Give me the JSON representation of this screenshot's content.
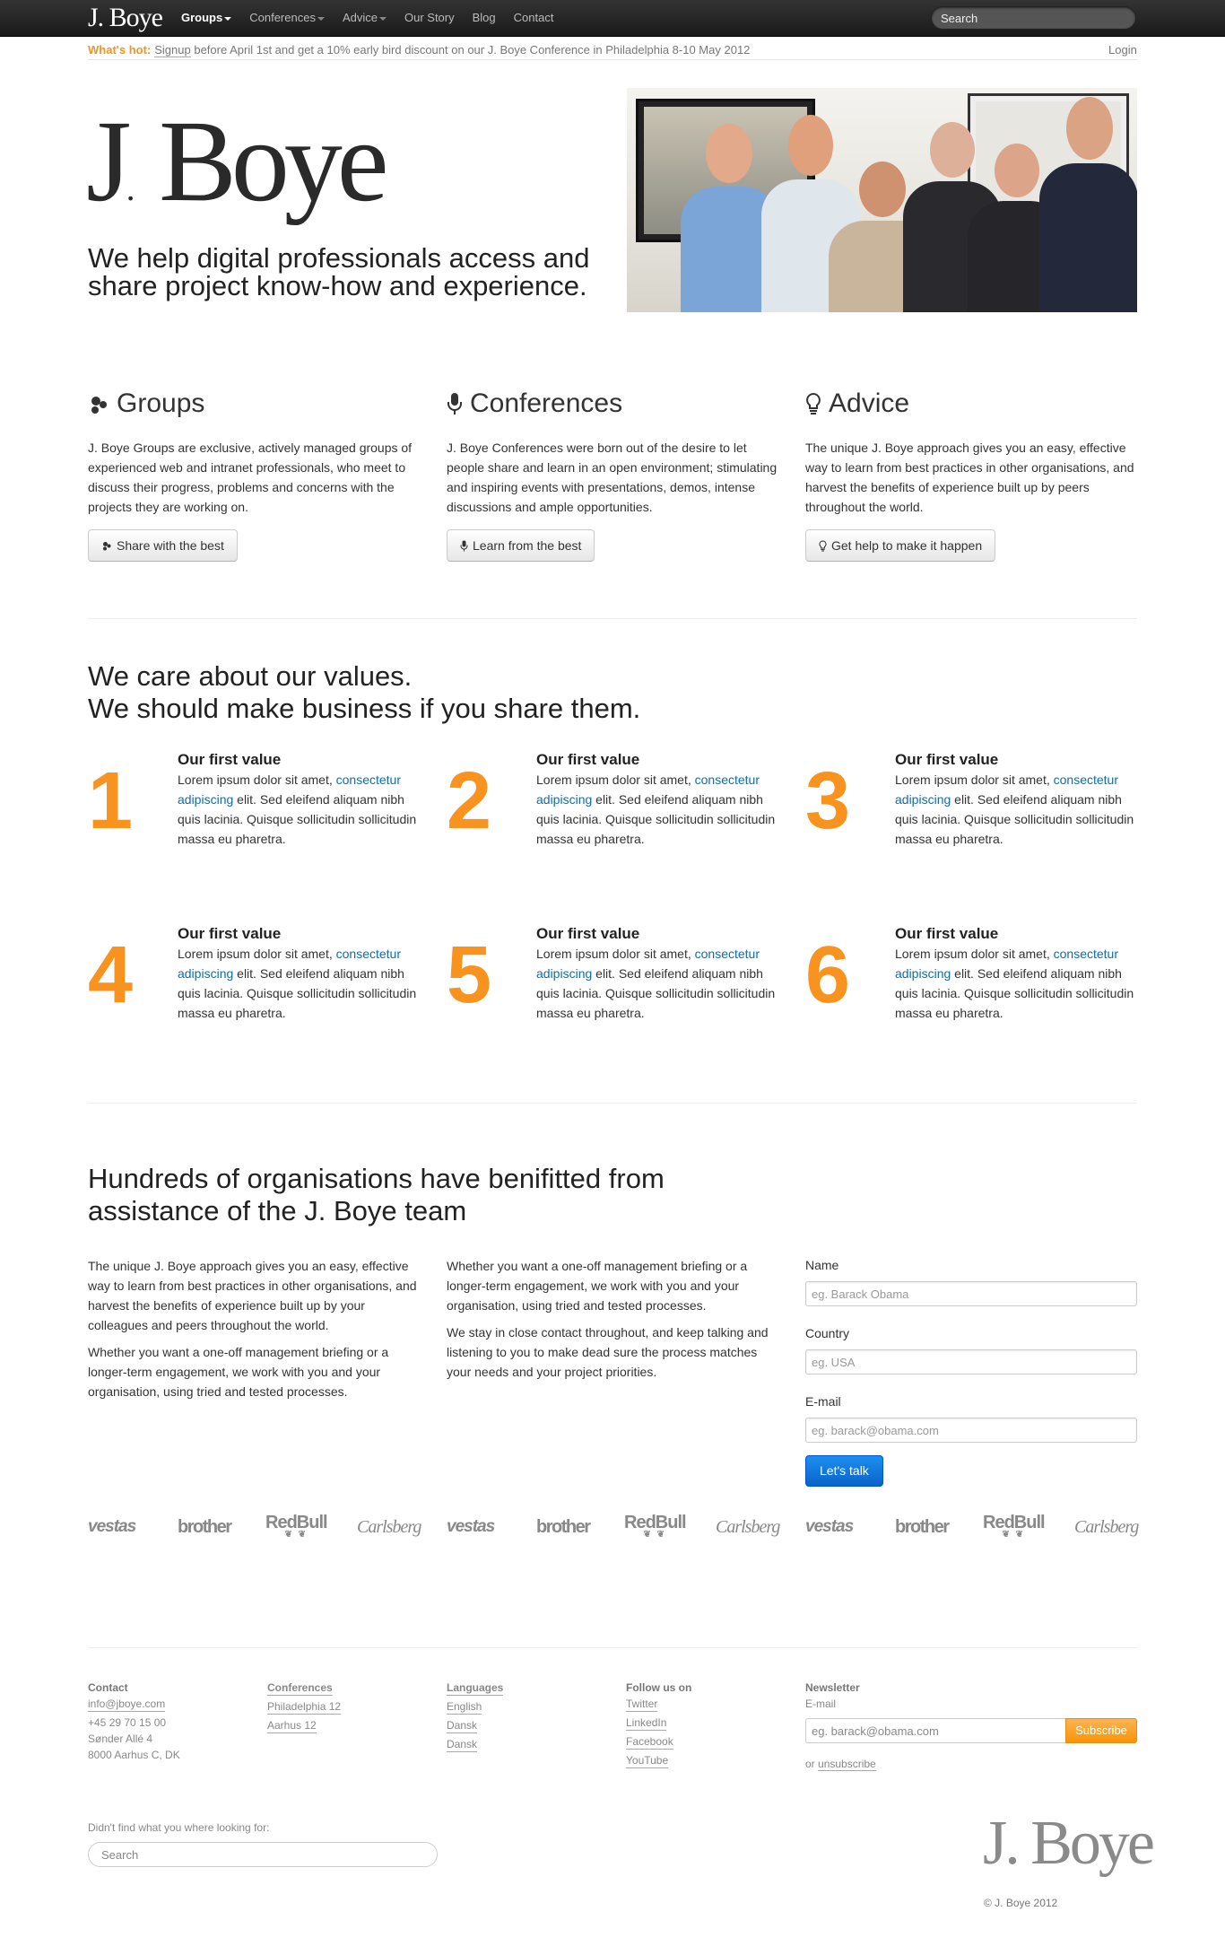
{
  "brand": {
    "logo": "J. Boye",
    "dot": "."
  },
  "nav": {
    "items": [
      {
        "label": "Groups",
        "caret": true,
        "active": true
      },
      {
        "label": "Conferences",
        "caret": true
      },
      {
        "label": "Advice",
        "caret": true
      },
      {
        "label": "Our Story"
      },
      {
        "label": "Blog"
      },
      {
        "label": "Contact"
      }
    ],
    "search_placeholder": "Search"
  },
  "hot": {
    "label": "What's hot:",
    "link": "Signup",
    "text": " before April 1st and get a 10% early bird discount on our J. Boye Conference in Philadelphia 8-10 May 2012",
    "login": "Login"
  },
  "hero": {
    "logo_j": "J",
    "logo_dot": ".",
    "logo_rest": " Boye",
    "tagline": "We help digital professionals access and share project know-how and experience."
  },
  "features": [
    {
      "title": "Groups",
      "icon": "groups-icon",
      "text": "J. Boye Groups are exclusive, actively managed groups of experienced web and intranet professionals, who meet to discuss their progress, problems and concerns with the projects they are working on.",
      "button": "Share with the best"
    },
    {
      "title": "Conferences",
      "icon": "microphone-icon",
      "text": "J. Boye Conferences were born out of the desire to let people share and learn in an open environment; stimulating and inspiring events with presentations, demos, intense discussions and ample opportunities.",
      "button": "Learn from the best"
    },
    {
      "title": "Advice",
      "icon": "lightbulb-icon",
      "text": "The unique J. Boye approach gives you an easy, effective way to learn from best practices in other organisations, and harvest the benefits of experience built up by peers throughout the world.",
      "button": "Get help to make it happen"
    }
  ],
  "values": {
    "title_line1": "We care about our values.",
    "title_line2": "We should make business if you share them.",
    "items": [
      {
        "num": "1",
        "title": "Our first value",
        "pre": "Lorem ipsum dolor sit amet, ",
        "link": "consectetur adipiscing",
        "post": " elit. Sed eleifend aliquam nibh quis lacinia. Quisque sollicitudin sollicitudin massa eu pharetra."
      },
      {
        "num": "2",
        "title": "Our first value",
        "pre": "Lorem ipsum dolor sit amet, ",
        "link": "consectetur adipiscing",
        "post": " elit. Sed eleifend aliquam nibh quis lacinia. Quisque sollicitudin sollicitudin massa eu pharetra."
      },
      {
        "num": "3",
        "title": "Our first value",
        "pre": "Lorem ipsum dolor sit amet, ",
        "link": "consectetur adipiscing",
        "post": " elit. Sed eleifend aliquam nibh quis lacinia. Quisque sollicitudin sollicitudin massa eu pharetra."
      },
      {
        "num": "4",
        "title": "Our first value",
        "pre": "Lorem ipsum dolor sit amet, ",
        "link": "consectetur adipiscing",
        "post": " elit. Sed eleifend aliquam nibh quis lacinia. Quisque sollicitudin sollicitudin massa eu pharetra."
      },
      {
        "num": "5",
        "title": "Our first value",
        "pre": "Lorem ipsum dolor sit amet, ",
        "link": "consectetur adipiscing",
        "post": " elit. Sed eleifend aliquam nibh quis lacinia. Quisque sollicitudin sollicitudin massa eu pharetra."
      },
      {
        "num": "6",
        "title": "Our first value",
        "pre": "Lorem ipsum dolor sit amet, ",
        "link": "consectetur adipiscing",
        "post": " elit. Sed eleifend aliquam nibh quis lacinia. Quisque sollicitudin sollicitudin massa eu pharetra."
      }
    ]
  },
  "assist": {
    "title": "Hundreds of organisations have benifitted from assistance of the J. Boye team",
    "col1": [
      "The unique J. Boye approach gives you an easy, effective way to learn from best practices in other organisations, and harvest the benefits of experience built up by your colleagues and peers throughout the world.",
      "Whether you want a one-off management briefing or a longer-term engagement, we work with you and your organisation, using tried and tested processes."
    ],
    "col2": [
      "Whether you want a one-off management briefing or a longer-term engagement, we work with you and your organisation, using tried and tested processes.",
      "We stay in close contact throughout, and keep talking and listening to you to make dead sure the process matches your needs and your project priorities."
    ]
  },
  "form": {
    "name_label": "Name",
    "name_placeholder": "eg. Barack Obama",
    "country_label": "Country",
    "country_placeholder": "eg. USA",
    "email_label": "E-mail",
    "email_placeholder": "eg. barack@obama.com",
    "submit": "Let's talk"
  },
  "clients": [
    {
      "name": "vestas",
      "text": "vestas"
    },
    {
      "name": "brother",
      "text": "brother"
    },
    {
      "name": "redbull",
      "text": "RedBull",
      "sub": "❦ ❦"
    },
    {
      "name": "carlsberg",
      "text": "Carlsberg"
    },
    {
      "name": "vestas",
      "text": "vestas"
    },
    {
      "name": "brother",
      "text": "brother"
    },
    {
      "name": "redbull",
      "text": "RedBull",
      "sub": "❦ ❦"
    },
    {
      "name": "carlsberg",
      "text": "Carlsberg"
    },
    {
      "name": "vestas",
      "text": "vestas"
    },
    {
      "name": "brother",
      "text": "brother"
    },
    {
      "name": "redbull",
      "text": "RedBull",
      "sub": "❦ ❦"
    },
    {
      "name": "carlsberg",
      "text": "Carlsberg"
    }
  ],
  "footer": {
    "contact": {
      "title": "Contact",
      "email": "info@jboye.com",
      "phone": "+45 29 70 15 00",
      "street": "Sønder Allé 4",
      "city": "8000 Aarhus C, DK"
    },
    "conferences": {
      "title": "Conferences",
      "items": [
        "Philadelphia 12",
        "Aarhus 12"
      ]
    },
    "languages": {
      "title": "Languages",
      "items": [
        "English",
        "Dansk",
        "Dansk"
      ]
    },
    "follow": {
      "title": "Follow us on",
      "items": [
        "Twitter",
        "LinkedIn",
        "Facebook",
        "YouTube"
      ]
    },
    "newsletter": {
      "title": "Newsletter",
      "email_label": "E-mail",
      "placeholder": "eg. barack@obama.com",
      "button": "Subscribe",
      "or": "or ",
      "unsubscribe": "unsubscribe"
    },
    "didnt_find": "Didn't find what you where looking for:",
    "search_placeholder": "Search",
    "logo": "J. Boye",
    "copyright": "© J. Boye 2012"
  },
  "colors": {
    "accent": "#f7931e",
    "link": "#0a6eb3",
    "button_primary": "#0a62c9"
  }
}
